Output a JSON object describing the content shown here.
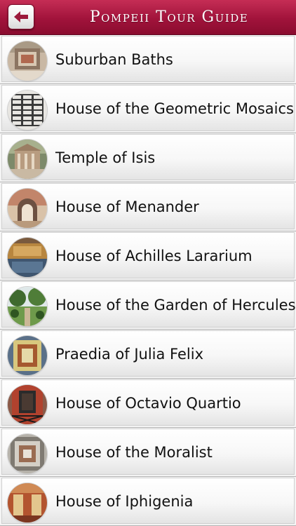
{
  "header": {
    "title": "Pompeii Tour Guide",
    "back_icon": "back-arrow-icon"
  },
  "colors": {
    "header_top": "#c52d55",
    "header_bottom": "#8a0c2f",
    "row_bg": "#f4f4f4"
  },
  "list": {
    "items": [
      {
        "label": "Suburban Baths"
      },
      {
        "label": "House of the Geometric Mosaics"
      },
      {
        "label": "Temple of Isis"
      },
      {
        "label": "House of Menander"
      },
      {
        "label": "House of Achilles Lararium"
      },
      {
        "label": "House of the Garden of Hercules"
      },
      {
        "label": "Praedia of Julia Felix"
      },
      {
        "label": "House of Octavio Quartio"
      },
      {
        "label": "House of the Moralist"
      },
      {
        "label": "House of Iphigenia"
      }
    ]
  }
}
